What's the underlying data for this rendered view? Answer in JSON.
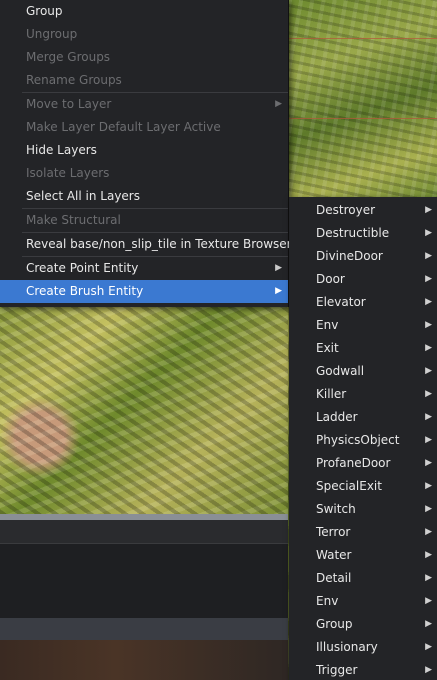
{
  "main_menu": {
    "items": [
      {
        "label": "Group",
        "disabled": false
      },
      {
        "label": "Ungroup",
        "disabled": true
      },
      {
        "label": "Merge Groups",
        "disabled": true
      },
      {
        "label": "Rename Groups",
        "disabled": true
      },
      {
        "label": "Move to Layer",
        "disabled": true,
        "submenu": true
      },
      {
        "label": "Make Layer Default Layer Active",
        "disabled": true
      },
      {
        "label": "Hide Layers",
        "disabled": false
      },
      {
        "label": "Isolate Layers",
        "disabled": true
      },
      {
        "label": "Select All in Layers",
        "disabled": false
      },
      {
        "label": "Make Structural",
        "disabled": true
      },
      {
        "label": "Reveal base/non_slip_tile in Texture Browser",
        "disabled": false
      },
      {
        "label": "Create Point Entity",
        "disabled": false,
        "submenu": true
      },
      {
        "label": "Create Brush Entity",
        "disabled": false,
        "submenu": true,
        "selected": true
      }
    ]
  },
  "brush_submenu": {
    "items": [
      "Destroyer",
      "Destructible",
      "DivineDoor",
      "Door",
      "Elevator",
      "Env",
      "Exit",
      "Godwall",
      "Killer",
      "Ladder",
      "PhysicsObject",
      "ProfaneDoor",
      "SpecialExit",
      "Switch",
      "Terror",
      "Water",
      "Detail",
      "Env",
      "Group",
      "Illusionary",
      "Trigger"
    ]
  },
  "colors": {
    "menu_bg": "#232427",
    "highlight": "#3b79d1",
    "text": "#e8e8e8",
    "disabled_text": "#6c6d70"
  },
  "icons": {
    "submenu_arrow": "▶"
  }
}
